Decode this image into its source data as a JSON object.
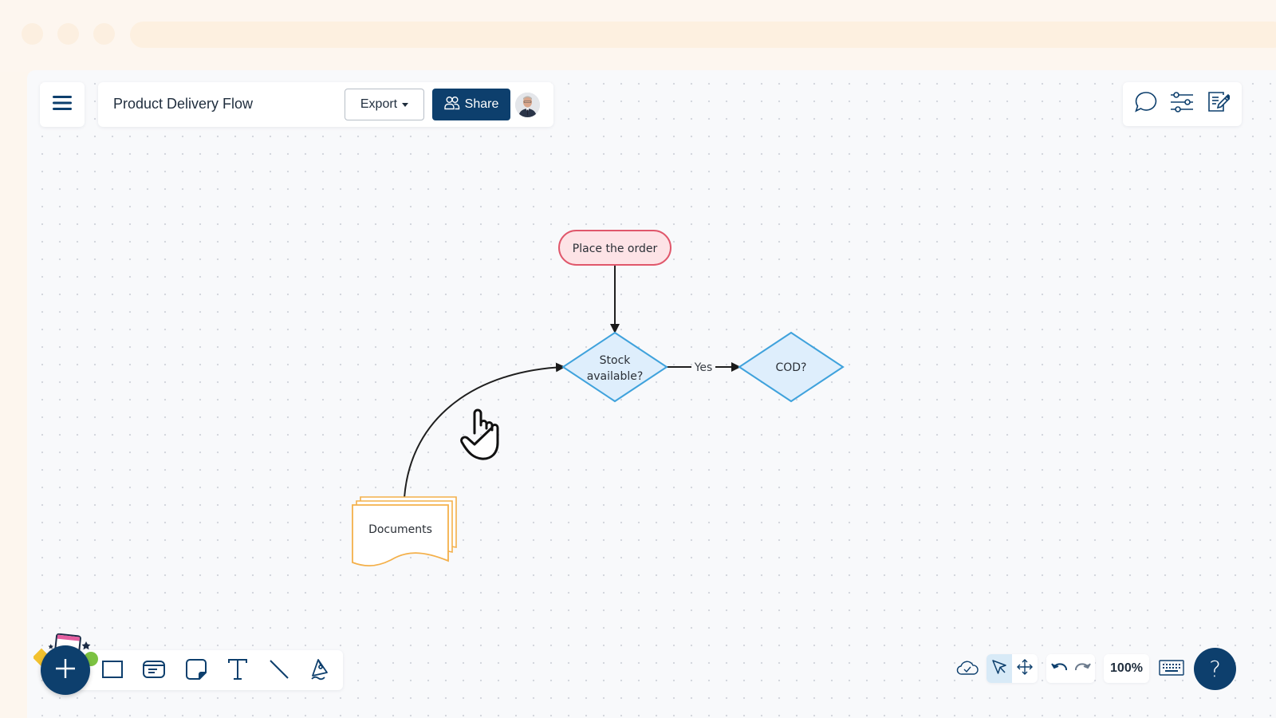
{
  "browser": {
    "window_controls": [
      "close",
      "minimize",
      "maximize"
    ]
  },
  "header": {
    "menu_icon": "hamburger-menu-icon",
    "document_title": "Product Delivery Flow",
    "export_label": "Export",
    "share_label": "Share",
    "avatar_alt": "User avatar"
  },
  "right_toolbar": {
    "items": [
      {
        "name": "comments",
        "icon": "speech-bubble-icon"
      },
      {
        "name": "settings",
        "icon": "sliders-icon"
      },
      {
        "name": "notes",
        "icon": "edit-document-icon"
      }
    ]
  },
  "diagram": {
    "nodes": [
      {
        "id": "place-order",
        "type": "terminator",
        "label": "Place the order",
        "fill": "#fde3e6",
        "stroke": "#e0576b"
      },
      {
        "id": "stock-available",
        "type": "decision",
        "label_lines": [
          "Stock",
          "available?"
        ],
        "fill": "#deeefc",
        "stroke": "#3fa2dc"
      },
      {
        "id": "cod",
        "type": "decision",
        "label": "COD?",
        "fill": "#deeefc",
        "stroke": "#3fa2dc"
      },
      {
        "id": "documents",
        "type": "multi-document",
        "label": "Documents",
        "fill": "#ffffff",
        "stroke": "#f4b04a"
      }
    ],
    "edges": [
      {
        "from": "place-order",
        "to": "stock-available",
        "label": ""
      },
      {
        "from": "stock-available",
        "to": "cod",
        "label": "Yes"
      },
      {
        "from": "documents",
        "to": "stock-available",
        "label": ""
      }
    ]
  },
  "bottom_toolbar": {
    "add_label": "+",
    "tools": [
      {
        "name": "rectangle",
        "icon": "rectangle-icon"
      },
      {
        "name": "card",
        "icon": "card-icon"
      },
      {
        "name": "sticky-note",
        "icon": "sticky-note-icon"
      },
      {
        "name": "text",
        "icon": "text-icon"
      },
      {
        "name": "line",
        "icon": "line-icon"
      },
      {
        "name": "pen",
        "icon": "pen-icon"
      }
    ]
  },
  "status_bar": {
    "save_status_icon": "cloud-saved-icon",
    "select_tool": "pointer-icon",
    "pan_tool": "move-icon",
    "undo": "undo-icon",
    "redo": "redo-icon",
    "zoom_level": "100%",
    "keyboard": "keyboard-icon",
    "help_label": "?"
  },
  "colors": {
    "brand": "#0d3f6d",
    "canvas": "#f8f9fb",
    "chrome": "#fdf6ee",
    "selected_tool_bg": "#d8eaf7"
  }
}
